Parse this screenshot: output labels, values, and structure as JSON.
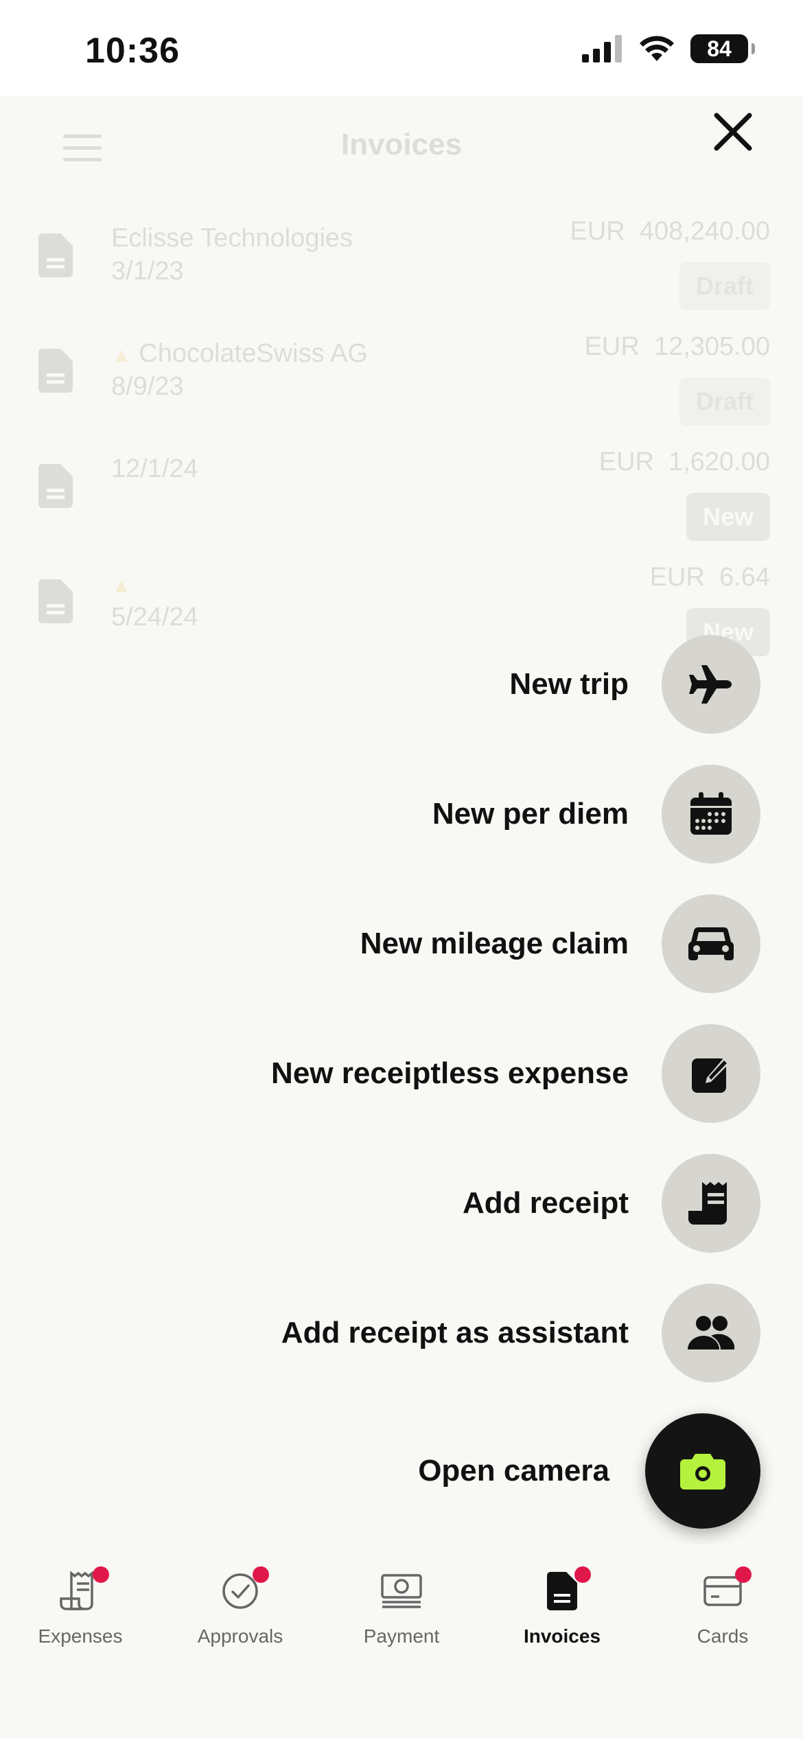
{
  "status_bar": {
    "time": "10:36",
    "battery": "84"
  },
  "header": {
    "title": "Invoices"
  },
  "invoices": [
    {
      "name": "Eclisse Technologies",
      "date": "3/1/23",
      "currency": "EUR",
      "amount": "408,240.00",
      "status": "Draft",
      "warning": false
    },
    {
      "name": "ChocolateSwiss AG",
      "date": "8/9/23",
      "currency": "EUR",
      "amount": "12,305.00",
      "status": "Draft",
      "warning": true
    },
    {
      "name": "",
      "date": "12/1/24",
      "currency": "EUR",
      "amount": "1,620.00",
      "status": "New",
      "warning": false
    },
    {
      "name": "",
      "date": "5/24/24",
      "currency": "EUR",
      "amount": "6.64",
      "status": "New",
      "warning": true
    }
  ],
  "menu": {
    "items": [
      {
        "label": "New trip",
        "icon": "airplane-icon"
      },
      {
        "label": "New per diem",
        "icon": "calendar-icon"
      },
      {
        "label": "New mileage claim",
        "icon": "car-icon"
      },
      {
        "label": "New receiptless expense",
        "icon": "edit-icon"
      },
      {
        "label": "Add receipt",
        "icon": "receipt-icon"
      },
      {
        "label": "Add receipt as assistant",
        "icon": "people-icon"
      }
    ],
    "camera": {
      "label": "Open camera",
      "icon": "camera-icon"
    }
  },
  "tabs": [
    {
      "label": "Expenses",
      "icon": "receipt-icon",
      "badge": true,
      "active": false
    },
    {
      "label": "Approvals",
      "icon": "check-circle-icon",
      "badge": true,
      "active": false
    },
    {
      "label": "Payment",
      "icon": "banknote-icon",
      "badge": false,
      "active": false
    },
    {
      "label": "Invoices",
      "icon": "document-icon",
      "badge": true,
      "active": true
    },
    {
      "label": "Cards",
      "icon": "credit-card-icon",
      "badge": true,
      "active": false
    }
  ],
  "colors": {
    "accent": "#b5f23d",
    "badge": "#e0184a",
    "fab_bg": "#d6d5cf",
    "overlay": "#f8f8f5"
  }
}
